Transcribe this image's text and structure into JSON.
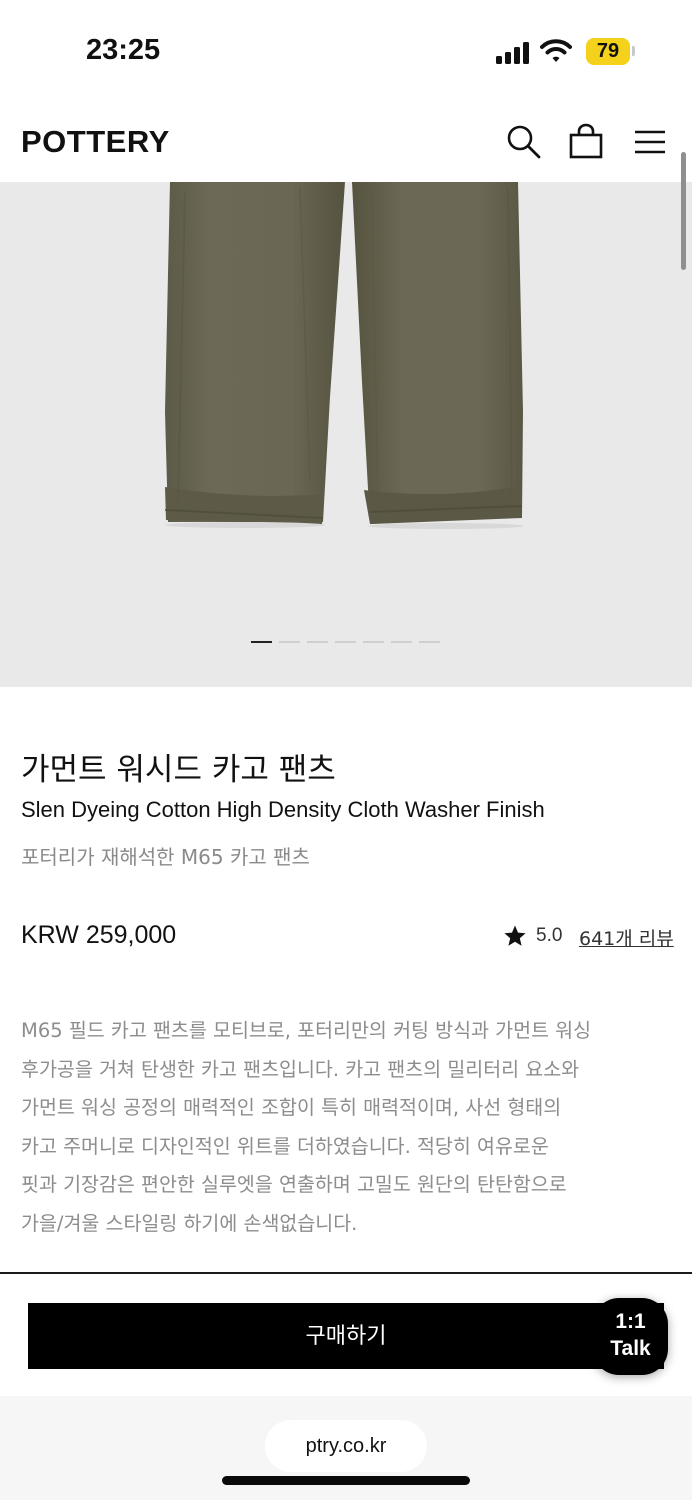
{
  "status_bar": {
    "time": "23:25",
    "battery_level": "79",
    "battery_color": "#f4d21c",
    "icons": [
      "cellular-signal-icon",
      "wifi-icon",
      "battery-icon"
    ]
  },
  "header": {
    "logo": "POTTERY",
    "icons": [
      "search-icon",
      "shopping-bag-icon",
      "hamburger-menu-icon"
    ]
  },
  "gallery": {
    "image_subject": "olive cargo pants lower legs",
    "slide_count": 7,
    "active_slide": 1,
    "background_color": "#e9e9e9"
  },
  "product": {
    "title_ko": "가먼트 워시드 카고 팬츠",
    "title_en": "Slen Dyeing Cotton High Density Cloth Washer Finish",
    "subtitle": "포터리가 재해석한 M65 카고 팬츠",
    "price": "KRW 259,000",
    "rating": "5.0",
    "review_link": "641개 리뷰",
    "description_lines": [
      "M65 필드 카고 팬츠를 모티브로, 포터리만의 커팅 방식과 가먼트 워싱",
      "후가공을 거쳐 탄생한 카고 팬츠입니다. 카고 팬츠의 밀리터리 요소와",
      "가먼트 워싱 공정의 매력적인 조합이 특히 매력적이며, 사선 형태의",
      "카고 주머니로 디자인적인 위트를 더하였습니다. 적당히 여유로운",
      "핏과 기장감은 편안한 실루엣을 연출하며 고밀도 원단의 탄탄함으로",
      "가을/겨울 스타일링 하기에 손색없습니다."
    ]
  },
  "actions": {
    "buy_label": "구매하기",
    "talk_line1": "1:1",
    "talk_line2": "Talk"
  },
  "browser": {
    "url": "ptry.co.kr"
  }
}
